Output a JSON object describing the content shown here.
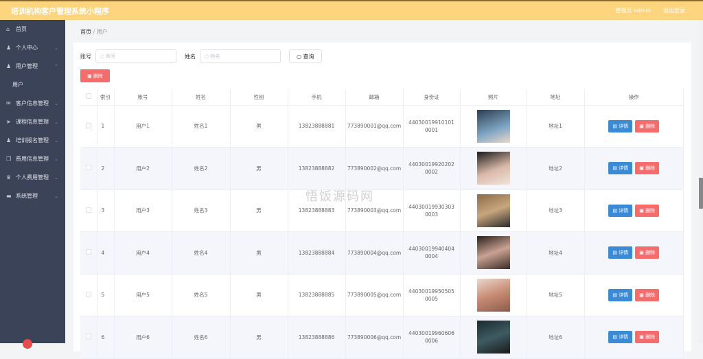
{
  "header": {
    "title": "培训机构客户管理系统小程序",
    "user": "管理员 admin",
    "logout": "退出登录"
  },
  "sidebar": {
    "items": [
      {
        "label": "首页",
        "icon": "home-icon",
        "glyph": "⌂",
        "chev": ""
      },
      {
        "label": "个人中心",
        "icon": "user-icon",
        "glyph": "♟",
        "chev": "⌄"
      },
      {
        "label": "用户管理",
        "icon": "user-icon",
        "glyph": "♟",
        "chev": "⌃"
      },
      {
        "label": "用户",
        "icon": "",
        "glyph": "",
        "chev": "",
        "sub": true
      },
      {
        "label": "客户信息管理",
        "icon": "mail-icon",
        "glyph": "✉",
        "chev": "⌄"
      },
      {
        "label": "课程信息管理",
        "icon": "send-icon",
        "glyph": "➤",
        "chev": "⌄"
      },
      {
        "label": "培训报名管理",
        "icon": "user-icon",
        "glyph": "♟",
        "chev": "⌄"
      },
      {
        "label": "费用信息管理",
        "icon": "copy-icon",
        "glyph": "❐",
        "chev": "⌄"
      },
      {
        "label": "个人费用管理",
        "icon": "trophy-icon",
        "glyph": "♛",
        "chev": "⌄"
      },
      {
        "label": "系统管理",
        "icon": "monitor-icon",
        "glyph": "▬",
        "chev": "⌄"
      }
    ]
  },
  "breadcrumb": {
    "home": "首页",
    "sep": "/",
    "current": "用户"
  },
  "search": {
    "account_label": "账号",
    "account_placeholder": "账号",
    "name_label": "姓名",
    "name_placeholder": "姓名",
    "query": "查询"
  },
  "delete_label": "删除",
  "table": {
    "headers": [
      "",
      "索引",
      "账号",
      "姓名",
      "性别",
      "手机",
      "邮箱",
      "身份证",
      "照片",
      "地址",
      "操作"
    ],
    "rows": [
      {
        "index": "1",
        "account": "用户1",
        "name": "姓名1",
        "gender": "男",
        "phone": "13823888881",
        "email": "773890001@qq.com",
        "id": "440300199101010001",
        "address": "地址1"
      },
      {
        "index": "2",
        "account": "用户2",
        "name": "姓名2",
        "gender": "男",
        "phone": "13823888882",
        "email": "773890002@qq.com",
        "id": "440300199202020002",
        "address": "地址2"
      },
      {
        "index": "3",
        "account": "用户3",
        "name": "姓名3",
        "gender": "男",
        "phone": "13823888883",
        "email": "773890003@qq.com",
        "id": "440300199303030003",
        "address": "地址3"
      },
      {
        "index": "4",
        "account": "用户4",
        "name": "姓名4",
        "gender": "男",
        "phone": "13823888884",
        "email": "773890004@qq.com",
        "id": "440300199404040004",
        "address": "地址4"
      },
      {
        "index": "5",
        "account": "用户5",
        "name": "姓名5",
        "gender": "男",
        "phone": "13823888885",
        "email": "773890005@qq.com",
        "id": "440300199505050005",
        "address": "地址5"
      },
      {
        "index": "6",
        "account": "用户6",
        "name": "姓名6",
        "gender": "男",
        "phone": "13823888886",
        "email": "773890006@qq.com",
        "id": "440300199606060006",
        "address": "地址6"
      }
    ],
    "detail_label": "详情",
    "delete_label": "删除"
  },
  "watermark": "悟饭源码网",
  "colors": {
    "header": "#fdd57f",
    "sidebar": "#3b4358",
    "danger": "#f56c6c",
    "primary": "#3a8ad6"
  }
}
